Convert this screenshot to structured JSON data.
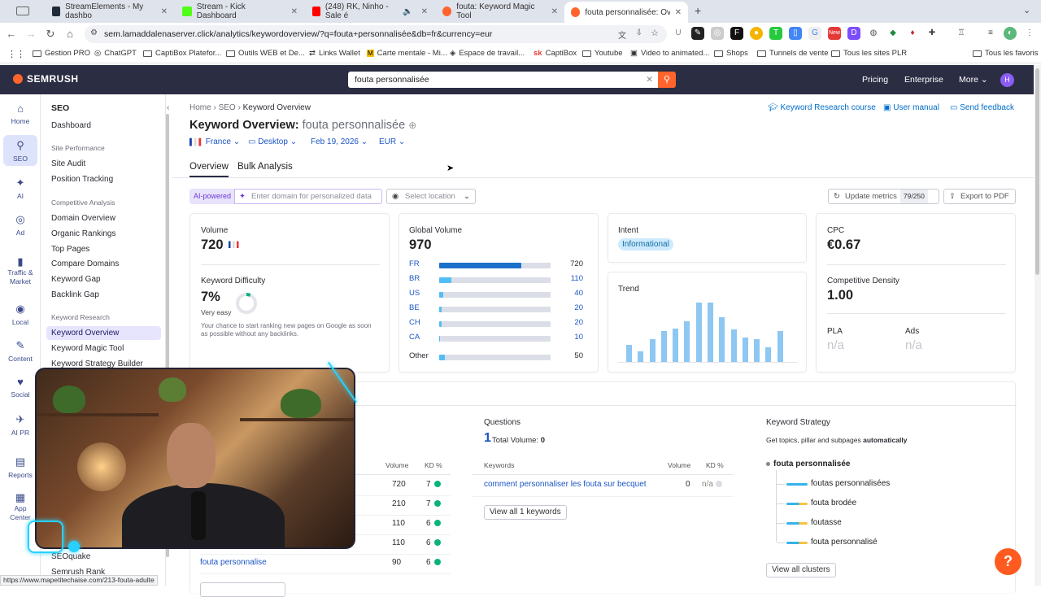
{
  "browser": {
    "tabs": [
      {
        "title": "StreamElements - My dashbo",
        "color": "#1f2b38"
      },
      {
        "title": "Stream - Kick Dashboard",
        "color": "#53fc18"
      },
      {
        "title": "(248) RK, Ninho - Sale é",
        "color": "#ff0000"
      },
      {
        "title": "fouta: Keyword Magic Tool",
        "color": "#ff642d"
      },
      {
        "title": "fouta personnalisée: Overvie",
        "color": "#ff642d"
      }
    ],
    "url": "sem.lamaddalenaserver.click/analytics/keywordoverview/?q=fouta+personnalisée&db=fr&currency=eur",
    "bookmarks": [
      "Gestion PRO",
      "ChatGPT",
      "CaptiBox Platefor...",
      "Outils WEB et De...",
      "Links Wallet",
      "Carte mentale - Mi...",
      "Espace de travail...",
      "CaptiBox",
      "Youtube",
      "Video to animated...",
      "Shops",
      "Tunnels de vente",
      "Tous les sites PLR",
      "Tous les favoris"
    ]
  },
  "topbar": {
    "logo": "SEMRUSH",
    "search_value": "fouta personnalisée",
    "nav": [
      "Pricing",
      "Enterprise",
      "More"
    ],
    "avatar": "H"
  },
  "rail": [
    {
      "label": "Home",
      "icon": "⌂"
    },
    {
      "label": "SEO",
      "icon": "⚲"
    },
    {
      "label": "AI",
      "icon": "✦"
    },
    {
      "label": "Ad",
      "icon": "◎"
    },
    {
      "label": "Traffic &\nMarket",
      "icon": "▮"
    },
    {
      "label": "Local",
      "icon": "◉"
    },
    {
      "label": "Content",
      "icon": "✎"
    },
    {
      "label": "Social",
      "icon": "♥"
    },
    {
      "label": "AI PR",
      "icon": "✈"
    },
    {
      "label": "Reports",
      "icon": "▤"
    },
    {
      "label": "App\nCenter",
      "icon": "▦"
    }
  ],
  "sidebar": {
    "title": "SEO",
    "dashboard": "Dashboard",
    "sections": [
      {
        "name": "Site Performance",
        "items": [
          "Site Audit",
          "Position Tracking"
        ]
      },
      {
        "name": "Competitive Analysis",
        "items": [
          "Domain Overview",
          "Organic Rankings",
          "Top Pages",
          "Compare Domains",
          "Keyword Gap",
          "Backlink Gap"
        ]
      },
      {
        "name": "Keyword Research",
        "items": [
          "Keyword Overview",
          "Keyword Magic Tool",
          "Keyword Strategy Builder"
        ]
      }
    ],
    "bottom_items": [
      "SEOquake",
      "Semrush Rank"
    ]
  },
  "main": {
    "breadcrumb": [
      "Home",
      "SEO",
      "Keyword Overview"
    ],
    "links": [
      "Keyword Research course",
      "User manual",
      "Send feedback"
    ],
    "title_prefix": "Keyword Overview:",
    "keyword": "fouta personnalisée",
    "filters": [
      "France",
      "Desktop",
      "Feb 19, 2026",
      "EUR"
    ],
    "tabs": [
      "Overview",
      "Bulk Analysis"
    ],
    "ai_chip": "AI-powered",
    "domain_placeholder": "Enter domain for personalized data",
    "location_placeholder": "Select location",
    "update_label": "Update metrics",
    "update_badge": "79/250",
    "export_label": "Export to PDF"
  },
  "volume_card": {
    "label": "Volume",
    "value": "720",
    "kd_label": "Keyword Difficulty",
    "kd_value": "7%",
    "kd_text": "Very easy",
    "kd_desc": "Your chance to start ranking new pages on Google as soon as possible without any backlinks."
  },
  "global_card": {
    "label": "Global Volume",
    "value": "970",
    "rows": [
      {
        "cc": "FR",
        "val": "720",
        "frac": 0.74,
        "color": "#1c70c9"
      },
      {
        "cc": "BR",
        "val": "110",
        "frac": 0.11,
        "color": "#52bdf5"
      },
      {
        "cc": "US",
        "val": "40",
        "frac": 0.04,
        "color": "#52bdf5"
      },
      {
        "cc": "BE",
        "val": "20",
        "frac": 0.02,
        "color": "#52bdf5"
      },
      {
        "cc": "CH",
        "val": "20",
        "frac": 0.02,
        "color": "#52bdf5"
      },
      {
        "cc": "CA",
        "val": "10",
        "frac": 0.01,
        "color": "#52bdf5"
      }
    ],
    "other_label": "Other",
    "other_val": "50",
    "other_frac": 0.05
  },
  "intent_card": {
    "label": "Intent",
    "value": "Informational"
  },
  "trend_card": {
    "label": "Trend",
    "values": [
      0.28,
      0.18,
      0.38,
      0.52,
      0.55,
      0.68,
      0.99,
      0.99,
      0.75,
      0.54,
      0.4,
      0.38,
      0.25,
      0.52
    ]
  },
  "cpc_card": {
    "label": "CPC",
    "value": "€0.67",
    "density_label": "Competitive Density",
    "density_value": "1.00",
    "pla_label": "PLA",
    "pla_value": "n/a",
    "ads_label": "Ads",
    "ads_value": "n/a"
  },
  "variations": {
    "header_volume": "Volume",
    "header_kd": "KD %",
    "rows": [
      {
        "kw": "",
        "vol": "720",
        "kd": "7"
      },
      {
        "kw": "",
        "vol": "210",
        "kd": "7"
      },
      {
        "kw": "",
        "vol": "110",
        "kd": "6"
      },
      {
        "kw": "",
        "vol": "110",
        "kd": "6"
      },
      {
        "kw": "fouta personnalise",
        "vol": "90",
        "kd": "6"
      }
    ]
  },
  "questions": {
    "title": "Questions",
    "count": "1",
    "total_label": "Total Volume:",
    "total_val": "0",
    "headers": [
      "Keywords",
      "Volume",
      "KD %"
    ],
    "rows": [
      {
        "kw": "comment personnaliser les fouta sur becquet",
        "vol": "0",
        "kd": "n/a"
      }
    ],
    "view_all": "View all 1 keywords"
  },
  "strategy": {
    "title": "Keyword Strategy",
    "desc_prefix": "Get topics, pillar and subpages",
    "desc_bold": "automatically",
    "root": "fouta personnalisée",
    "items": [
      {
        "label": "foutas personnalisées",
        "color": "#36b3ea"
      },
      {
        "label": "fouta brodée",
        "color": "#36b3ea"
      },
      {
        "label": "foutasse",
        "color": "#36b3ea"
      },
      {
        "label": "fouta personnalisé",
        "color": "#36b3ea"
      }
    ],
    "view_all": "View all clusters"
  },
  "status_url": "https://www.mapetitechaise.com/213-fouta-adulte",
  "colors": {
    "brand": "#ff642d",
    "topbar": "#2b2d43",
    "link": "#1a55c5",
    "easy": "#09b37c"
  }
}
